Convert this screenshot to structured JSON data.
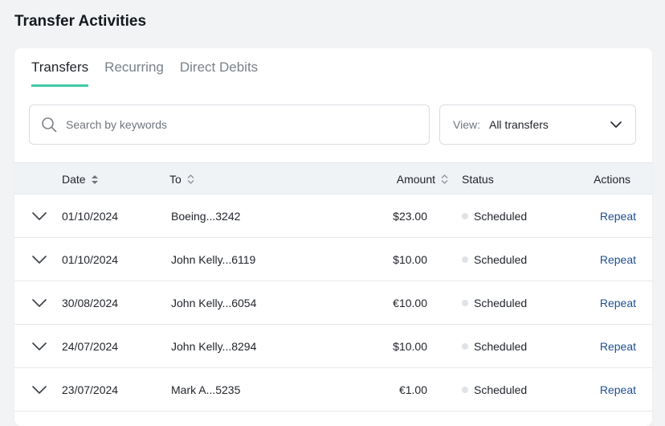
{
  "page": {
    "title": "Transfer Activities"
  },
  "tabs": [
    {
      "label": "Transfers",
      "active": true
    },
    {
      "label": "Recurring",
      "active": false
    },
    {
      "label": "Direct Debits",
      "active": false
    }
  ],
  "search": {
    "placeholder": "Search by keywords",
    "value": ""
  },
  "view_filter": {
    "label": "View:",
    "value": "All transfers"
  },
  "table": {
    "columns": {
      "date": "Date",
      "to": "To",
      "amount": "Amount",
      "status": "Status",
      "actions": "Actions"
    },
    "rows": [
      {
        "date": "01/10/2024",
        "to": "Boeing...3242",
        "amount": "$23.00",
        "status": "Scheduled",
        "action": "Repeat"
      },
      {
        "date": "01/10/2024",
        "to": "John Kelly...6119",
        "amount": "$10.00",
        "status": "Scheduled",
        "action": "Repeat"
      },
      {
        "date": "30/08/2024",
        "to": "John Kelly...6054",
        "amount": "€10.00",
        "status": "Scheduled",
        "action": "Repeat"
      },
      {
        "date": "24/07/2024",
        "to": "John Kelly...8294",
        "amount": "$10.00",
        "status": "Scheduled",
        "action": "Repeat"
      },
      {
        "date": "23/07/2024",
        "to": "Mark A...5235",
        "amount": "€1.00",
        "status": "Scheduled",
        "action": "Repeat"
      }
    ]
  },
  "colors": {
    "accent": "#3ecba6",
    "link": "#1d4f91",
    "status_dot": "#dfe3e8"
  },
  "icons": {
    "search": "search-icon",
    "dropdown": "chevron-down-icon",
    "sort": "sort-icon",
    "expand": "chevron-down-icon"
  }
}
